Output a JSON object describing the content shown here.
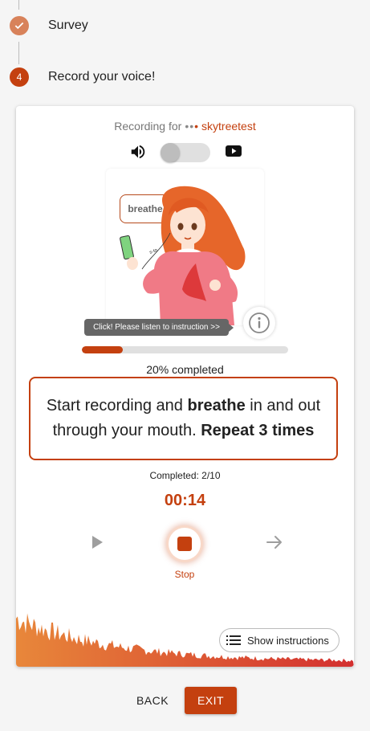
{
  "stepper": {
    "steps": [
      {
        "label": "Survey",
        "status": "completed",
        "icon": "check-icon"
      },
      {
        "number": "4",
        "label": "Record your voice!",
        "status": "active"
      }
    ]
  },
  "card": {
    "recording_for_label": "Recording for",
    "username": "skytreetest",
    "sound_toggle_on": false,
    "bubble_word": "breathe",
    "tooltip": "Click! Please listen to instruction >>",
    "progress": {
      "percent": 20,
      "text": "20% completed"
    },
    "instruction": {
      "part1": "Start recording and ",
      "bold1": "breathe",
      "part2": " in and out through your mouth. ",
      "bold2": "Repeat 3 times"
    },
    "completed_count": "Completed: 2/10",
    "timer": "00:14",
    "stop_label": "Stop",
    "show_instructions_label": "Show instructions"
  },
  "footer": {
    "back_label": "BACK",
    "exit_label": "EXIT"
  },
  "colors": {
    "accent": "#c4400f",
    "wave_start": "#e8873a",
    "wave_end": "#d32f2f"
  }
}
